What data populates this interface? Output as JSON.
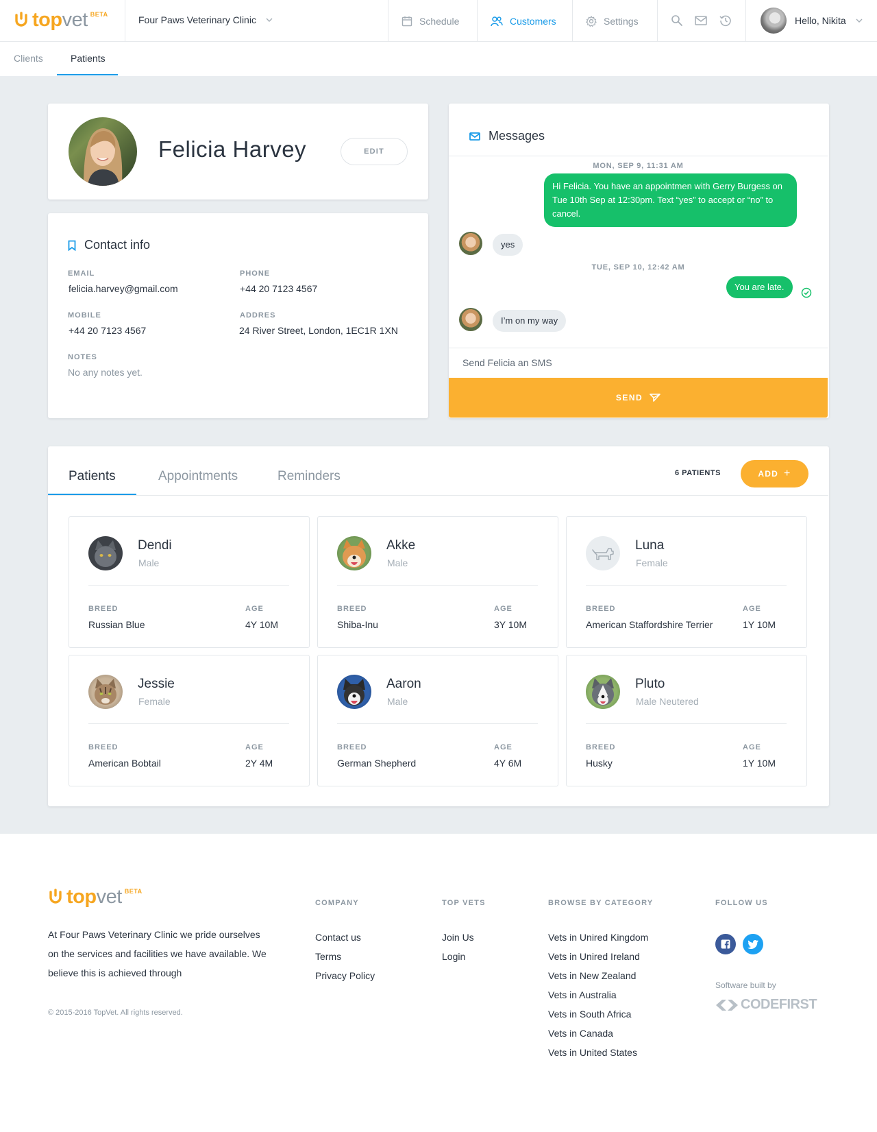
{
  "brand": {
    "name_bold": "top",
    "name_light": "vet",
    "beta": "BETA",
    "accent": "#f6a620",
    "blue": "#1a9be8",
    "green": "#16c06a",
    "orange": "#fbb030"
  },
  "header": {
    "clinic": "Four Paws Veterinary Clinic",
    "nav": [
      {
        "label": "Schedule",
        "icon": "calendar-icon"
      },
      {
        "label": "Customers",
        "icon": "people-icon",
        "active": true
      },
      {
        "label": "Settings",
        "icon": "gear-icon"
      }
    ],
    "icons": [
      "search-icon",
      "mail-icon",
      "history-icon"
    ],
    "greeting": "Hello, Nikita"
  },
  "subtabs": [
    "Clients",
    "Patients"
  ],
  "client": {
    "name": "Felicia Harvey",
    "edit_label": "EDIT"
  },
  "contact": {
    "title": "Contact info",
    "email_label": "EMAIL",
    "email": "felicia.harvey@gmail.com",
    "phone_label": "PHONE",
    "phone": "+44 20 7123 4567",
    "mobile_label": "MOBILE",
    "mobile": "+44 20 7123 4567",
    "address_label": "ADDRES",
    "address": "24 River Street, London, 1EC1R 1XN",
    "notes_label": "NOTES",
    "notes": "No any notes yet."
  },
  "messages": {
    "title": "Messages",
    "date1": "MON, SEP 9, 11:31 AM",
    "msg1": "Hi Felicia. You have an appointmen with Gerry Burgess on Tue 10th Sep at 12:30pm. Text “yes” to accept or “no” to cancel.",
    "reply1": "yes",
    "date2": "TUE, SEP 10, 12:42 AM",
    "msg2": "You are late.",
    "reply2": "I’m on my way",
    "input_placeholder": "Send Felicia an SMS",
    "send_label": "SEND"
  },
  "patients_panel": {
    "tabs": [
      "Patients",
      "Appointments",
      "Reminders"
    ],
    "count": "6 PATIENTS",
    "add_label": "ADD",
    "breed_label": "BREED",
    "age_label": "AGE",
    "pets": [
      {
        "name": "Dendi",
        "sex": "Male",
        "breed": "Russian Blue",
        "age": "4Y 10M"
      },
      {
        "name": "Akke",
        "sex": "Male",
        "breed": "Shiba-Inu",
        "age": "3Y 10M"
      },
      {
        "name": "Luna",
        "sex": "Female",
        "breed": "American Staffordshire Terrier",
        "age": "1Y 10M"
      },
      {
        "name": "Jessie",
        "sex": "Female",
        "breed": "American Bobtail",
        "age": "2Y 4M"
      },
      {
        "name": "Aaron",
        "sex": "Male",
        "breed": "German Shepherd",
        "age": "4Y 6M"
      },
      {
        "name": "Pluto",
        "sex": "Male Neutered",
        "breed": "Husky",
        "age": "1Y 10M"
      }
    ]
  },
  "footer": {
    "about": "At Four Paws Veterinary Clinic we pride ourselves on the services and facilities we have available. We believe this is achieved through",
    "copyright": "© 2015-2016 TopVet. All rights reserved.",
    "company_title": "COMPANY",
    "company_links": [
      "Contact us",
      "Terms",
      "Privacy Policy"
    ],
    "topvets_title": "TOP VETS",
    "topvets_links": [
      "Join Us",
      "Login"
    ],
    "browse_title": "BROWSE BY CATEGORY",
    "browse_links": [
      "Vets in Unired Kingdom",
      "Vets in Unired Ireland",
      "Vets in New Zealand",
      "Vets in Australia",
      "Vets in South Africa",
      "Vets in Canada",
      "Vets in United States"
    ],
    "follow_title": "FOLLOW US",
    "built_by": "Software built by",
    "builder": "CODEFIRST"
  }
}
